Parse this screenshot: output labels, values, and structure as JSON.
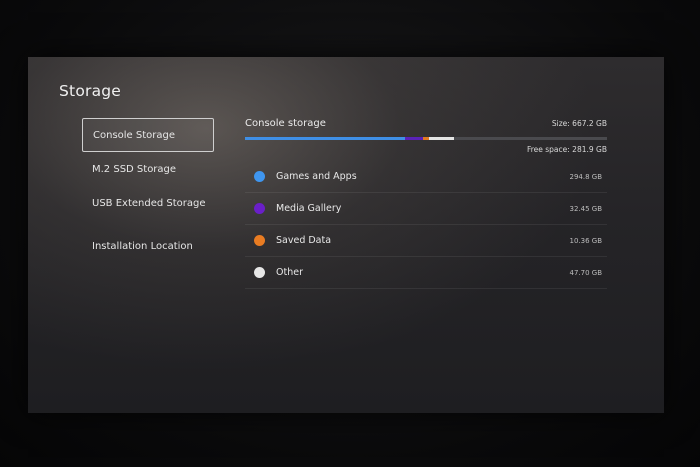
{
  "page": {
    "title": "Storage"
  },
  "sidebar": {
    "items": [
      {
        "label": "Console Storage",
        "selected": true
      },
      {
        "label": "M.2 SSD Storage",
        "selected": false
      },
      {
        "label": "USB Extended Storage",
        "selected": false
      },
      {
        "label": "Installation Location",
        "selected": false
      }
    ]
  },
  "storage": {
    "section_title": "Console storage",
    "size_text": "Size: 667.2 GB",
    "free_text": "Free space: 281.9 GB",
    "usage_bar": {
      "segments": [
        {
          "category": "Games and Apps",
          "fraction": 0.442,
          "color": "#3f8fe6"
        },
        {
          "category": "Media Gallery",
          "fraction": 0.049,
          "color": "#5a22b8"
        },
        {
          "category": "Saved Data",
          "fraction": 0.016,
          "color": "#e07a22"
        },
        {
          "category": "Other",
          "fraction": 0.071,
          "color": "#e4e4e4"
        }
      ],
      "free_color": "#4a4a4e"
    },
    "categories": [
      {
        "label": "Games and Apps",
        "size": "294.8 GB",
        "color": "#3f96f0"
      },
      {
        "label": "Media Gallery",
        "size": "32.45 GB",
        "color": "#6a1fc9"
      },
      {
        "label": "Saved Data",
        "size": "10.36 GB",
        "color": "#e97c22"
      },
      {
        "label": "Other",
        "size": "47.70 GB",
        "color": "#e6e6e6"
      }
    ]
  }
}
